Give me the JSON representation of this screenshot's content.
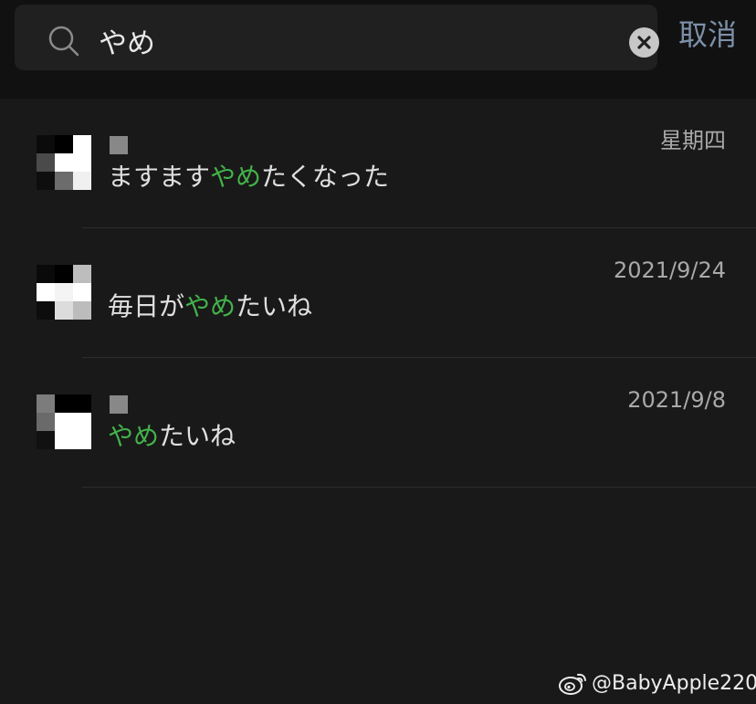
{
  "search": {
    "query": "やめ",
    "cancel_label": "取消"
  },
  "results": [
    {
      "date": "星期四",
      "snippet_before": "ますます",
      "snippet_highlight": "やめ",
      "snippet_after": "たくなった",
      "has_name_block": true
    },
    {
      "date": "2021/9/24",
      "snippet_before": "毎日が",
      "snippet_highlight": "やめ",
      "snippet_after": "たいね",
      "has_name_block": false
    },
    {
      "date": "2021/9/8",
      "snippet_before": "",
      "snippet_highlight": "やめ",
      "snippet_after": "たいね",
      "has_name_block": true
    }
  ],
  "watermark": {
    "text": "@BabyApple220",
    "icon": "weibo-icon"
  },
  "colors": {
    "background": "#191919",
    "header": "#111111",
    "highlight": "#43b24a",
    "cancel": "#7d90a9",
    "date": "#a9a9a9"
  }
}
